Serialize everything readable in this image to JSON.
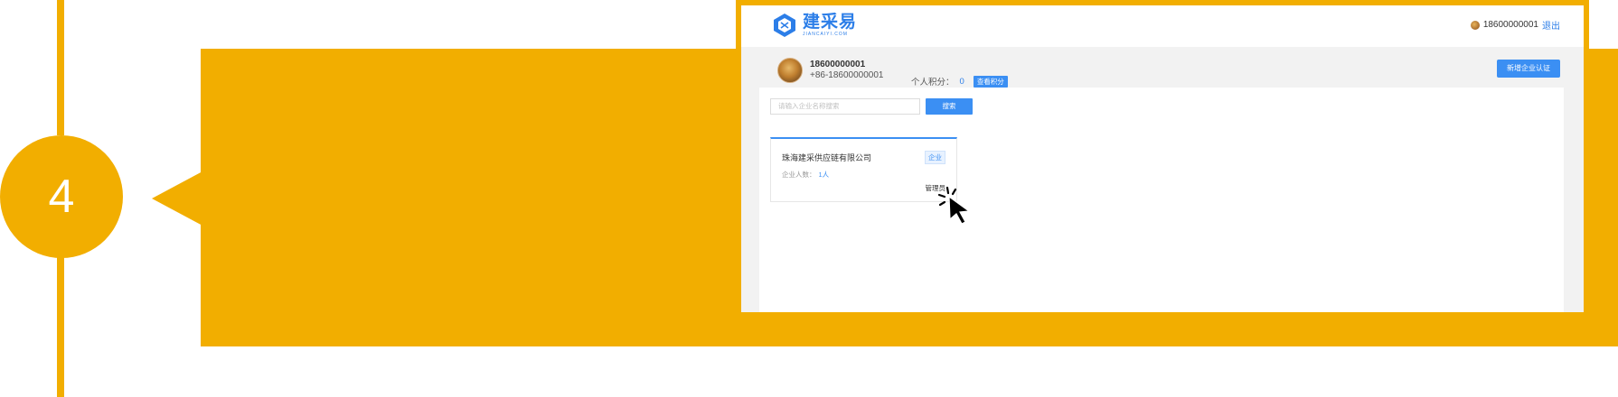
{
  "step": {
    "number": "4"
  },
  "header": {
    "logo_text": "建采易",
    "logo_subtext": "JIANCAIYI.COM",
    "user_phone": "18600000001",
    "logout_label": "退出",
    "avatar_icon": "user-avatar-icon"
  },
  "profile": {
    "name": "18600000001",
    "phone": "+86-18600000001",
    "points_label": "个人积分：",
    "points_value": "0",
    "view_points_label": "查看积分",
    "new_cert_label": "新增企业认证"
  },
  "search": {
    "placeholder": "请输入企业名称搜索",
    "button_label": "搜索"
  },
  "company_card": {
    "name": "珠海建采供应链有限公司",
    "badge": "企业",
    "member_label": "企业人数：",
    "member_value": "1人",
    "manage_label": "管理员"
  },
  "colors": {
    "accent_orange": "#f2ae00",
    "brand_blue": "#3b8ff3"
  },
  "cursor_icon": "hand-pointer-click-icon"
}
